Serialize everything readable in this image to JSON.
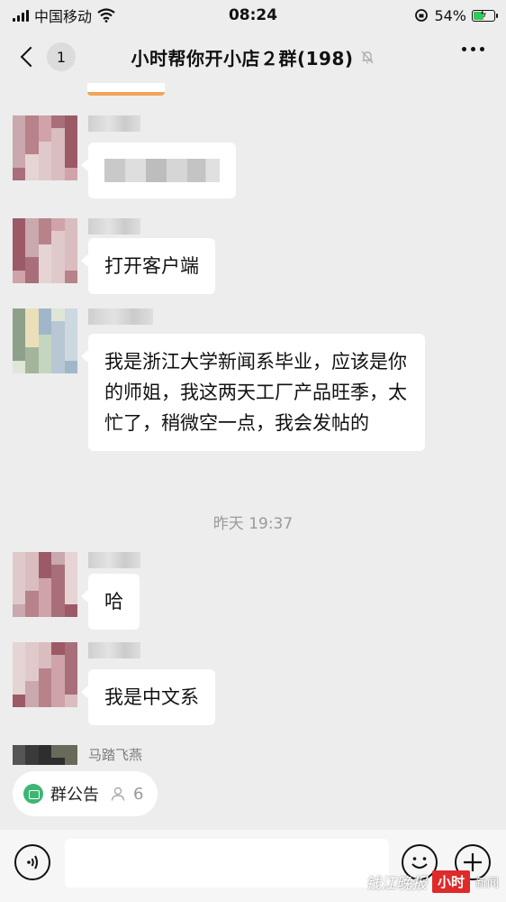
{
  "status_bar": {
    "carrier": "中国移动",
    "time": "08:24",
    "battery_pct": "54%",
    "battery_level": 0.54
  },
  "nav": {
    "back_badge": "1",
    "title": "小时帮你开小店２群(198)"
  },
  "messages": [
    {
      "sender": "",
      "text": ""
    },
    {
      "sender": "",
      "text": "打开客户端"
    },
    {
      "sender": "",
      "text": "我是浙江大学新闻系毕业，应该是你的师姐，我这两天工厂产品旺季，太忙了，稍微空一点，我会发帖的"
    },
    {
      "sender": "",
      "text": "哈"
    },
    {
      "sender": "",
      "text": "我是中文系"
    },
    {
      "sender": "马踏飞燕",
      "text": ""
    }
  ],
  "timestamp": "昨天 19:37",
  "notice": {
    "label": "群公告",
    "count": "6"
  },
  "watermark": {
    "script": "钱江晚报",
    "brand": "小时",
    "news": "新闻"
  },
  "colors": {
    "background": "#ededed",
    "bubble": "#ffffff",
    "notice_green": "#3eb575",
    "watermark_red": "#e02a2a"
  }
}
